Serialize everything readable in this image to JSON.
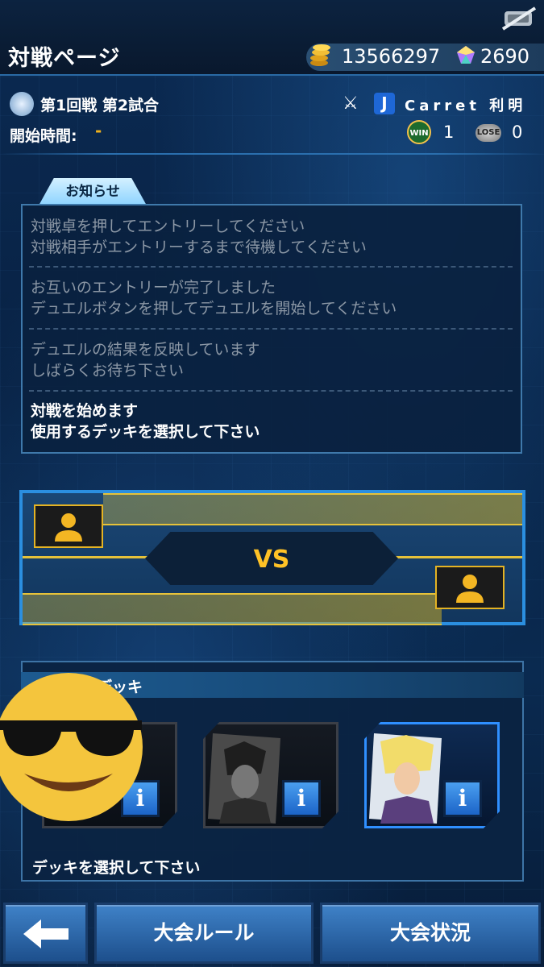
{
  "header": {
    "page_title": "対戦ページ",
    "gold_amount": "13566297",
    "gem_amount": "2690",
    "gold_icon": "gold-coins-icon",
    "gem_icon": "gem-icon",
    "duel_status_icon": "duel-disabled-icon"
  },
  "match": {
    "title": "第1回戦 第2試合",
    "start_label": "開始時間:",
    "start_value": "-",
    "opponent_rank": "J",
    "opponent_name": "Carret 利明",
    "win_label": "WIN",
    "win_count": "1",
    "lose_label": "LOSE",
    "lose_count": "0"
  },
  "notice": {
    "tab_label": "お知らせ",
    "items": [
      "対戦卓を押してエントリーしてください\n対戦相手がエントリーするまで待機してください",
      "お互いのエントリーが完了しました\nデュエルボタンを押してデュエルを開始してください",
      "デュエルの結果を反映しています\nしばらくお待ち下さい",
      "対戦を始めます\n使用するデッキを選択して下さい"
    ]
  },
  "versus": {
    "label": "VS"
  },
  "deck": {
    "header": "デッキ",
    "info_label": "i",
    "hint": "デッキを選択して下さい",
    "selected_index": 2
  },
  "footer": {
    "back_icon": "back-arrow-icon",
    "rules_label": "大会ルール",
    "status_label": "大会状況"
  },
  "colors": {
    "accent_gold": "#ffc226",
    "panel_border": "#2b8fe0"
  }
}
